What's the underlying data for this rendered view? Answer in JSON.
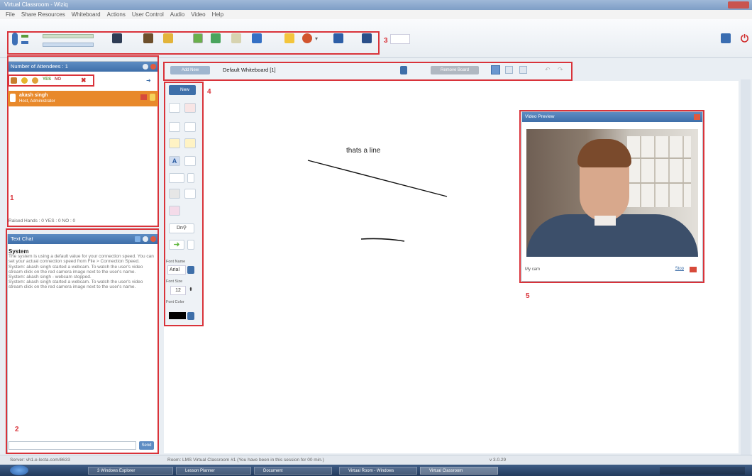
{
  "window": {
    "title": "Virtual Classroom - Wiziq"
  },
  "menu": [
    "File",
    "Share Resources",
    "Whiteboard",
    "Actions",
    "User Control",
    "Audio",
    "Video",
    "Help"
  ],
  "labels": {
    "n1": "1",
    "n2": "2",
    "n3": "3",
    "n4": "4",
    "n5": "5"
  },
  "attendees": {
    "header": "Number of Attendees : 1",
    "user_name": "akash singh",
    "user_status": "Host, Administrator",
    "raised": "Raised Hands : 0     YES : 0     NO : 0"
  },
  "chat": {
    "header": "Text Chat",
    "system_title": "System",
    "lines": "The system is using a default value for your connection speed. You can set your actual connection speed from File > Connection Speed.\nSystem: akash singh started a webcam. To watch the user's video stream click on the red camera image next to the user's name.\nSystem: akash singh - webcam stopped.\nSystem: akash singh started a webcam. To watch the user's video stream click on the red camera image next to the user's name.",
    "send": "Send"
  },
  "whiteboard": {
    "add_btn": "Add New",
    "selected": "Default Whiteboard [1]",
    "remove_btn": "Remove Board",
    "new_btn": "New",
    "canvas_text": "thats a line",
    "font_name_label": "Font Name",
    "font_name": "Arial",
    "font_size_label": "Font Size",
    "font_size": "12",
    "font_color_label": "Font Color",
    "font_color": "#000000"
  },
  "video": {
    "header": "Video Preview",
    "caption": "My cam",
    "stop": "Stop"
  },
  "status": {
    "server": "Server: vh1.e-lecta.com/8633",
    "room": "Room: LMS Virtual Classroom #1 (You have been in this session for 00 min.)",
    "version": "v 3.0.29"
  },
  "taskbar": {
    "items": [
      "3 Windows Explorer",
      "Lesson Planner",
      "Document",
      "Virtual Room - Windows",
      "Virtual Classroom"
    ]
  },
  "colors": {
    "accent": "#3e6fa9",
    "highlight_red": "#d9333a",
    "attendee_orange": "#e8892b"
  }
}
